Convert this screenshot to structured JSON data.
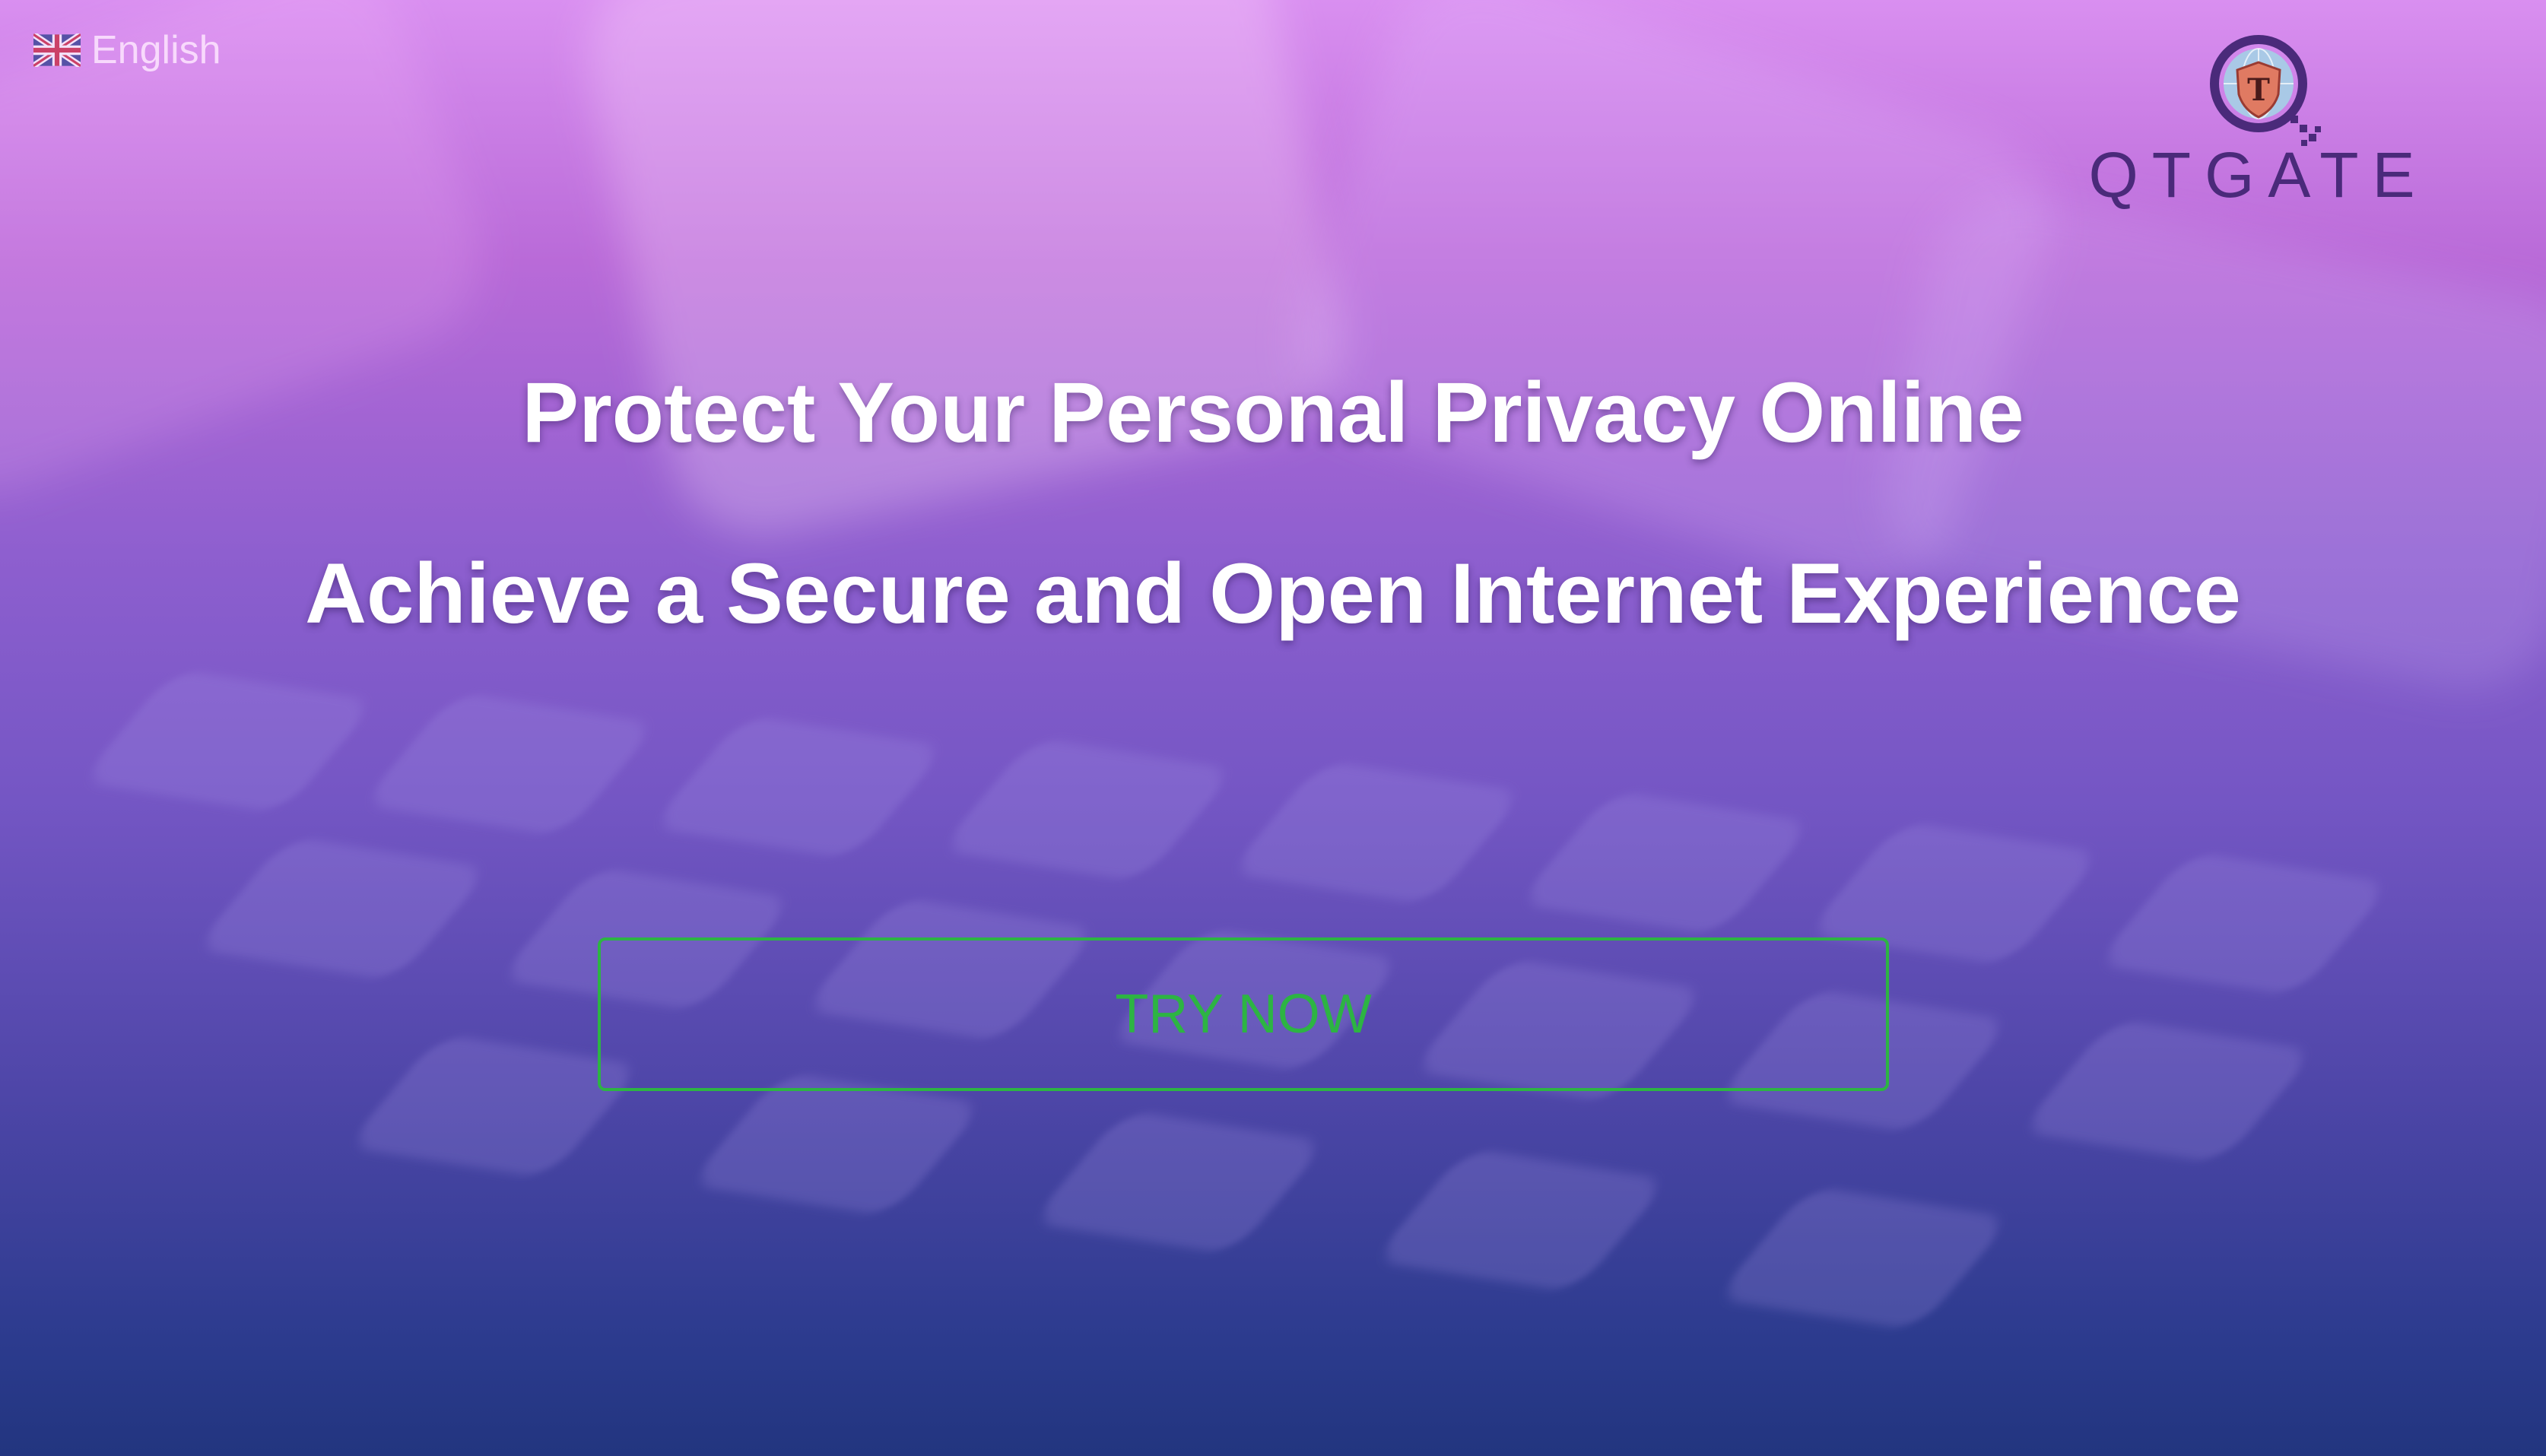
{
  "language": {
    "label": "English",
    "flag_icon": "uk-flag-icon"
  },
  "brand": {
    "name": "QTGATE",
    "logo_icon": "shield-globe-logo-icon",
    "logo_mark_letter": "T",
    "color": "#4a2a7a"
  },
  "hero": {
    "headline_1": "Protect Your Personal Privacy Online",
    "headline_2": "Achieve a Secure and Open Internet Experience"
  },
  "cta": {
    "label": "TRY NOW",
    "color": "#2db443"
  },
  "theme": {
    "gradient_top": "#d98ff0",
    "gradient_bottom": "#22357f",
    "headline_color": "#ffffff"
  }
}
